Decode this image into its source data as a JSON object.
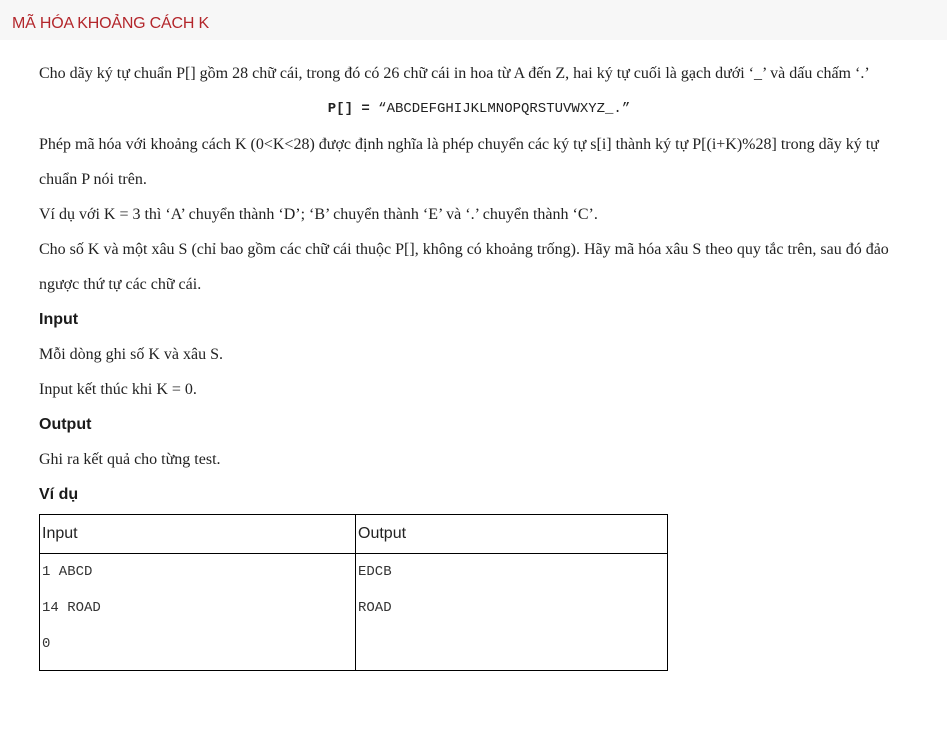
{
  "header": {
    "title": "MÃ HÓA KHOẢNG CÁCH K"
  },
  "problem": {
    "intro": "Cho dãy ký tự chuẩn P[] gồm 28 chữ cái, trong đó có 26 chữ cái in hoa từ A đến Z, hai ký tự cuối là gạch dưới ‘_’ và dấu chấm ‘.’",
    "formula_lhs": "P[] =",
    "formula_rhs": " “ABCDEFGHIJKLMNOPQRSTUVWXYZ_.”",
    "definition": "Phép mã hóa với khoảng cách K (0<K<28) được định nghĩa là phép chuyển các ký tự s[i] thành ký tự P[(i+K)%28] trong dãy ký tự chuẩn P nói trên.",
    "example_text": "Ví dụ với K = 3 thì ‘A’ chuyển thành ‘D’; ‘B’ chuyển thành ‘E’ và ‘.’ chuyển thành ‘C’.",
    "task": "Cho số K và một xâu S (chỉ bao gồm các chữ cái thuộc P[], không có khoảng trống). Hãy mã hóa xâu S theo quy tắc trên, sau đó đảo ngược thứ tự các chữ cái."
  },
  "input_section": {
    "heading": "Input",
    "line1": "Mỗi dòng ghi số K và xâu S.",
    "line2": "Input kết thúc khi K = 0."
  },
  "output_section": {
    "heading": "Output",
    "line1": "Ghi ra kết quả cho từng test."
  },
  "example_section": {
    "heading": "Ví dụ",
    "table": {
      "headers": [
        "Input",
        "Output"
      ],
      "input_lines": [
        "1 ABCD",
        "14 ROAD",
        "0"
      ],
      "output_lines": [
        "EDCB",
        "ROAD",
        ""
      ]
    }
  }
}
